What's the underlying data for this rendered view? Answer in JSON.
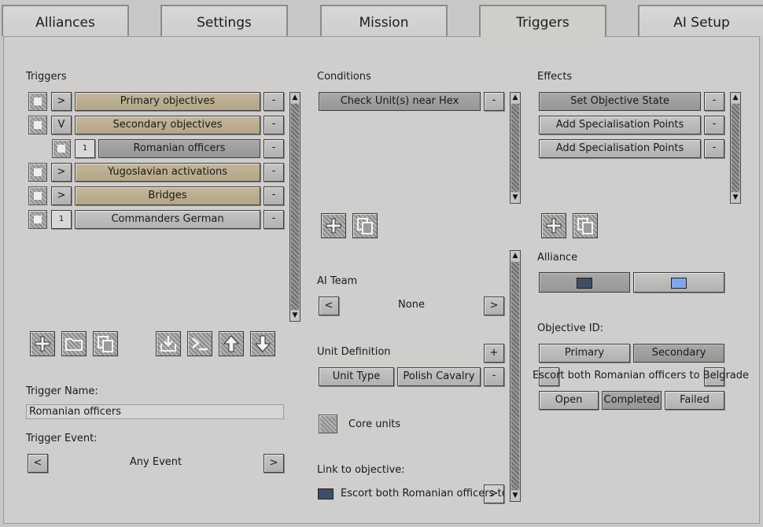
{
  "tabs": [
    "Alliances",
    "Settings",
    "Mission",
    "Triggers",
    "AI Setup"
  ],
  "triggers": {
    "title": "Triggers",
    "items": [
      {
        "toggle": ">",
        "label": "Primary objectives"
      },
      {
        "toggle": "V",
        "label": "Secondary objectives"
      },
      {
        "toggle": "1",
        "label": "Romanian officers"
      },
      {
        "toggle": ">",
        "label": "Yugoslavian activations"
      },
      {
        "toggle": ">",
        "label": "Bridges"
      },
      {
        "toggle": "1",
        "label": "Commanders German"
      }
    ],
    "remove_label": "-",
    "name_label": "Trigger Name:",
    "name_value": "Romanian officers",
    "event_label": "Trigger Event:",
    "event_value": "Any Event",
    "prev": "<",
    "next": ">"
  },
  "conditions": {
    "title": "Conditions",
    "items": [
      "Check Unit(s) near Hex"
    ],
    "remove_label": "-",
    "ai_team_label": "AI Team",
    "ai_team_value": "None",
    "prev": "<",
    "next": ">",
    "unit_def_label": "Unit Definition",
    "add_label": "+",
    "unit_type_label": "Unit Type",
    "unit_type_value": "Polish Cavalry",
    "core_units_label": "Core units",
    "link_label": "Link to objective:",
    "link_value": "Escort both Romanian officers to Be"
  },
  "effects": {
    "title": "Effects",
    "items": [
      "Set Objective State",
      "Add Specialisation Points",
      "Add Specialisation Points"
    ],
    "remove_label": "-",
    "alliance_label": "Alliance",
    "alliance_colors": [
      "#3d4f66",
      "#7fa6ee"
    ],
    "objective_id_label": "Objective ID:",
    "primary_label": "Primary",
    "secondary_label": "Secondary",
    "objective_text": "Escort both Romanian officers to Belgrade",
    "states": [
      "Open",
      "Completed",
      "Failed"
    ]
  },
  "icons": {
    "add": "plus-icon",
    "folder": "folder-icon",
    "copy": "copy-icon",
    "import": "import-icon",
    "console": "console-icon",
    "up": "arrow-up-icon",
    "down": "arrow-down-icon"
  }
}
